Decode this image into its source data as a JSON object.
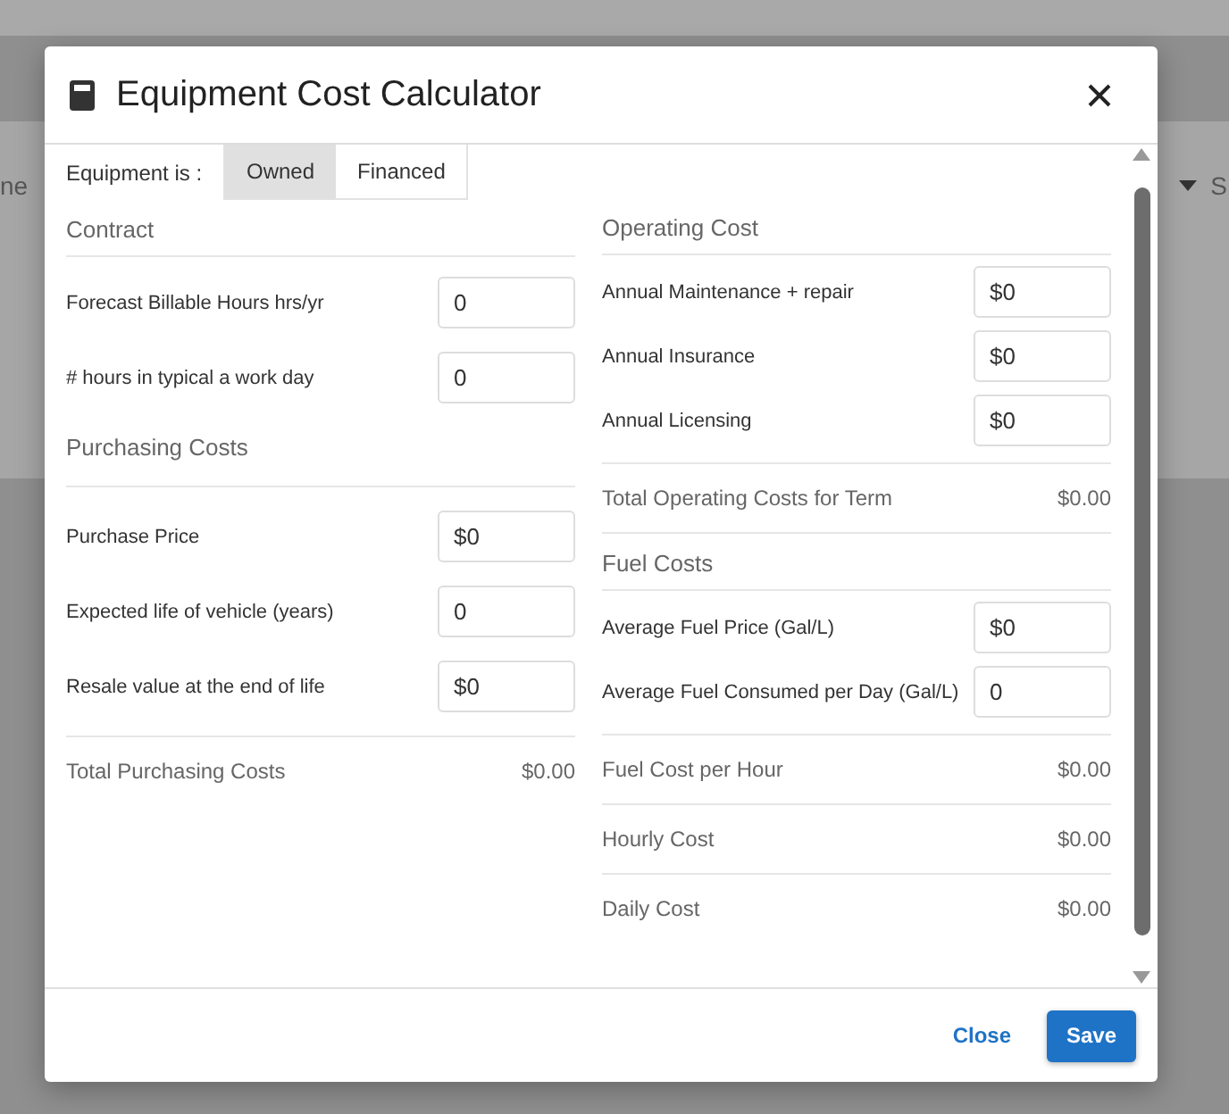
{
  "background": {
    "left_text": "ne",
    "right_text": "S"
  },
  "dialog": {
    "title": "Equipment Cost Calculator"
  },
  "ownership": {
    "label": "Equipment is :",
    "options": [
      {
        "label": "Owned",
        "selected": true
      },
      {
        "label": "Financed",
        "selected": false
      }
    ]
  },
  "left_column": [
    {
      "kind": "heading",
      "label": "Contract"
    },
    {
      "kind": "input",
      "label": "Forecast Billable Hours hrs/yr",
      "value": "0"
    },
    {
      "kind": "input",
      "label": "# hours in typical a work day",
      "value": "0"
    },
    {
      "kind": "heading",
      "label": "Purchasing Costs"
    },
    {
      "kind": "input",
      "label": "Purchase Price",
      "value": "$0"
    },
    {
      "kind": "input",
      "label": "Expected life of vehicle (years)",
      "value": "0"
    },
    {
      "kind": "input",
      "label": "Resale value at the end of life",
      "value": "$0"
    },
    {
      "kind": "total",
      "label": "Total Purchasing Costs",
      "value": "$0.00"
    }
  ],
  "right_column": [
    {
      "kind": "heading",
      "label": "Operating Cost"
    },
    {
      "kind": "input",
      "label": "Annual Maintenance + repair",
      "value": "$0"
    },
    {
      "kind": "input",
      "label": "Annual Insurance",
      "value": "$0"
    },
    {
      "kind": "input",
      "label": "Annual Licensing",
      "value": "$0"
    },
    {
      "kind": "total",
      "label": "Total Operating Costs for Term",
      "value": "$0.00"
    },
    {
      "kind": "heading",
      "label": "Fuel Costs"
    },
    {
      "kind": "input",
      "label": "Average Fuel Price (Gal/L)",
      "value": "$0"
    },
    {
      "kind": "input",
      "label": "Average Fuel Consumed per Day (Gal/L)",
      "value": "0"
    },
    {
      "kind": "total",
      "label": "Fuel Cost per Hour",
      "value": "$0.00"
    },
    {
      "kind": "total",
      "label": "Hourly Cost",
      "value": "$0.00"
    },
    {
      "kind": "total",
      "label": "Daily Cost",
      "value": "$0.00"
    }
  ],
  "footer": {
    "buttons": [
      {
        "label": "Close",
        "kind": "link"
      },
      {
        "label": "Save",
        "kind": "primary"
      }
    ]
  }
}
